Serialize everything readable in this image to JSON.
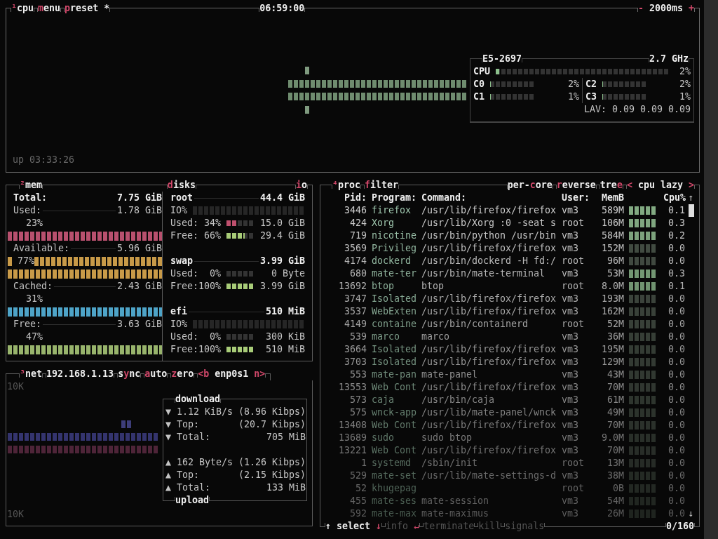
{
  "cpu": {
    "tabs": [
      {
        "parts": [
          {
            "text": "¹",
            "hot": true
          },
          {
            "text": "cpu",
            "hot": false
          }
        ]
      },
      {
        "parts": [
          {
            "text": "m",
            "hot": true
          },
          {
            "text": "enu",
            "hot": false
          }
        ]
      },
      {
        "parts": [
          {
            "text": "p",
            "hot": true
          },
          {
            "text": "reset *",
            "hot": false
          }
        ]
      }
    ],
    "clock": "06:59:00",
    "interval": {
      "parts": [
        {
          "text": "-",
          "hot": true
        },
        {
          "text": " 2000ms ",
          "hot": false
        },
        {
          "text": "+",
          "hot": true
        }
      ]
    },
    "cpu_model": "E5-2697",
    "frequency": "2.7 GHz",
    "total": {
      "label": "CPU",
      "level": 0.02,
      "reading": "2%"
    },
    "cores": [
      {
        "label": "C0",
        "level": 0.02,
        "reading": "2%"
      },
      {
        "label": "C1",
        "level": 0.01,
        "reading": "1%"
      },
      {
        "label": "C2",
        "level": 0.02,
        "reading": "2%"
      },
      {
        "label": "C3",
        "level": 0.01,
        "reading": "1%"
      }
    ],
    "load_average": {
      "label": "LAV:",
      "values": [
        "0.09",
        "0.09",
        "0.09"
      ]
    },
    "uptime": "up 03:33:26"
  },
  "mem": {
    "title": {
      "parts": [
        {
          "text": "²",
          "hot": true
        },
        {
          "text": "mem",
          "hot": false
        }
      ]
    },
    "items": [
      {
        "kind": "total",
        "label": "Total:",
        "value": "7.75 GiB"
      },
      {
        "kind": "stacked",
        "label": "Used:",
        "value": "1.78 GiB",
        "percent": "23%",
        "color": "#b8506e"
      },
      {
        "kind": "inline",
        "label": "Available:",
        "value": "5.96 GiB",
        "percent": "77%",
        "color": "#c89a48"
      },
      {
        "kind": "stacked",
        "label": "Cached:",
        "value": "2.43 GiB",
        "percent": "31%",
        "color": "#4ea4c8"
      },
      {
        "kind": "stacked",
        "label": "Free:",
        "value": "3.63 GiB",
        "percent": "47%",
        "color": "#98b46c"
      }
    ]
  },
  "disks": {
    "title": {
      "parts": [
        {
          "text": "d",
          "hot": true
        },
        {
          "text": "isks",
          "hot": false
        }
      ]
    },
    "io_button": {
      "parts": [
        {
          "text": "i",
          "hot": true
        },
        {
          "text": "o",
          "hot": false
        }
      ]
    },
    "items": [
      {
        "name": "root",
        "size": "44.4 GiB",
        "io_label": "IO%",
        "used": {
          "label": "Used:",
          "percent": "34%",
          "level": 0.34,
          "value": "15.0 GiB"
        },
        "free": {
          "label": "Free:",
          "percent": "66%",
          "level": 0.66,
          "value": "29.4 GiB"
        }
      },
      {
        "name": "swap",
        "size": "3.99 GiB",
        "used": {
          "label": "Used:",
          "percent": "0%",
          "level": 0,
          "value": "0 Byte"
        },
        "free": {
          "label": "Free:",
          "percent": "100%",
          "level": 1,
          "value": "3.99 GiB"
        }
      },
      {
        "name": "efi",
        "size": "510 MiB",
        "io_label": "IO%",
        "used": {
          "label": "Used:",
          "percent": "0%",
          "level": 0,
          "value": "300 KiB"
        },
        "free": {
          "label": "Free:",
          "percent": "100%",
          "level": 1,
          "value": "510 MiB"
        }
      }
    ]
  },
  "net": {
    "tabs": [
      {
        "parts": [
          {
            "text": "³",
            "hot": true
          },
          {
            "text": "net",
            "hot": false
          }
        ]
      },
      {
        "parts": [
          {
            "text": "192.168.1.13",
            "hot": false
          }
        ]
      },
      {
        "parts": [
          {
            "text": "s",
            "hot": false
          },
          {
            "text": "y",
            "hot": true
          },
          {
            "text": "nc",
            "hot": false
          }
        ]
      },
      {
        "parts": [
          {
            "text": "a",
            "hot": true
          },
          {
            "text": "uto",
            "hot": false
          }
        ]
      },
      {
        "parts": [
          {
            "text": "z",
            "hot": true
          },
          {
            "text": "ero",
            "hot": false
          }
        ]
      },
      {
        "parts": [
          {
            "text": "<b",
            "hot": true
          },
          {
            "text": " enp0s1 ",
            "hot": false
          },
          {
            "text": "n>",
            "hot": true
          }
        ]
      }
    ],
    "scale_top": "10K",
    "scale_bottom": "10K",
    "download": {
      "title": "download",
      "rows": [
        {
          "icon": "▼",
          "label": "1.12 KiB/s",
          "value": "(8.96 Kibps)"
        },
        {
          "icon": "▼",
          "label": "Top:",
          "value": "(20.7 Kibps)"
        },
        {
          "icon": "▼",
          "label": "Total:",
          "value": "705 MiB"
        }
      ]
    },
    "upload": {
      "title": "upload",
      "rows": [
        {
          "icon": "▲",
          "label": "162 Byte/s",
          "value": "(1.26 Kibps)"
        },
        {
          "icon": "▲",
          "label": "Top:",
          "value": "(2.15 Kibps)"
        },
        {
          "icon": "▲",
          "label": "Total:",
          "value": "133 MiB"
        }
      ]
    }
  },
  "proc": {
    "tabs_left": [
      {
        "parts": [
          {
            "text": "⁴",
            "hot": true
          },
          {
            "text": "proc",
            "hot": false
          }
        ]
      },
      {
        "parts": [
          {
            "text": "f",
            "hot": true
          },
          {
            "text": "ilter",
            "hot": false
          }
        ]
      }
    ],
    "tabs_right": [
      {
        "parts": [
          {
            "text": "per-",
            "hot": false
          },
          {
            "text": "c",
            "hot": true
          },
          {
            "text": "ore",
            "hot": false
          }
        ]
      },
      {
        "parts": [
          {
            "text": "r",
            "hot": true
          },
          {
            "text": "everse",
            "hot": false
          }
        ]
      },
      {
        "parts": [
          {
            "text": "tre",
            "hot": false
          },
          {
            "text": "e",
            "hot": true
          }
        ]
      },
      {
        "parts": [
          {
            "text": "<",
            "hot": true
          },
          {
            "text": " cpu lazy ",
            "hot": false
          },
          {
            "text": ">",
            "hot": true
          }
        ]
      }
    ],
    "columns": [
      "Pid:",
      "Program:",
      "Command:",
      "User:",
      "MemB",
      "Cpu%"
    ],
    "scroll_up": "↑",
    "scroll_down": "↓",
    "rows": [
      {
        "pid": "3446",
        "program": "firefox",
        "command": "/usr/lib/firefox/firefox",
        "user": "vm3",
        "mem": "589M",
        "cpu": "0.1"
      },
      {
        "pid": "424",
        "program": "Xorg",
        "command": "/usr/lib/Xorg :0 -seat s",
        "user": "root",
        "mem": "106M",
        "cpu": "0.3"
      },
      {
        "pid": "719",
        "program": "nicotine",
        "command": "/usr/bin/python /usr/bin",
        "user": "vm3",
        "mem": "584M",
        "cpu": "0.2"
      },
      {
        "pid": "3569",
        "program": "Privileg",
        "command": "/usr/lib/firefox/firefox",
        "user": "vm3",
        "mem": "152M",
        "cpu": "0.0"
      },
      {
        "pid": "4174",
        "program": "dockerd",
        "command": "/usr/bin/dockerd -H fd:/",
        "user": "root",
        "mem": "96M",
        "cpu": "0.0"
      },
      {
        "pid": "680",
        "program": "mate-ter",
        "command": "/usr/bin/mate-terminal",
        "user": "vm3",
        "mem": "53M",
        "cpu": "0.3"
      },
      {
        "pid": "13692",
        "program": "btop",
        "command": "btop",
        "user": "root",
        "mem": "8.0M",
        "cpu": "0.1"
      },
      {
        "pid": "3747",
        "program": "Isolated",
        "command": "/usr/lib/firefox/firefox",
        "user": "vm3",
        "mem": "193M",
        "cpu": "0.0"
      },
      {
        "pid": "3537",
        "program": "WebExten",
        "command": "/usr/lib/firefox/firefox",
        "user": "vm3",
        "mem": "162M",
        "cpu": "0.0"
      },
      {
        "pid": "4149",
        "program": "containe",
        "command": "/usr/bin/containerd",
        "user": "root",
        "mem": "52M",
        "cpu": "0.0"
      },
      {
        "pid": "539",
        "program": "marco",
        "command": "marco",
        "user": "vm3",
        "mem": "36M",
        "cpu": "0.0"
      },
      {
        "pid": "3664",
        "program": "Isolated",
        "command": "/usr/lib/firefox/firefox",
        "user": "vm3",
        "mem": "195M",
        "cpu": "0.0"
      },
      {
        "pid": "3703",
        "program": "Isolated",
        "command": "/usr/lib/firefox/firefox",
        "user": "vm3",
        "mem": "129M",
        "cpu": "0.0"
      },
      {
        "pid": "553",
        "program": "mate-pan",
        "command": "mate-panel",
        "user": "vm3",
        "mem": "43M",
        "cpu": "0.0"
      },
      {
        "pid": "13553",
        "program": "Web Cont",
        "command": "/usr/lib/firefox/firefox",
        "user": "vm3",
        "mem": "70M",
        "cpu": "0.0"
      },
      {
        "pid": "573",
        "program": "caja",
        "command": "/usr/bin/caja",
        "user": "vm3",
        "mem": "61M",
        "cpu": "0.0"
      },
      {
        "pid": "575",
        "program": "wnck-app",
        "command": "/usr/lib/mate-panel/wnck",
        "user": "vm3",
        "mem": "49M",
        "cpu": "0.0"
      },
      {
        "pid": "13408",
        "program": "Web Cont",
        "command": "/usr/lib/firefox/firefox",
        "user": "vm3",
        "mem": "70M",
        "cpu": "0.0"
      },
      {
        "pid": "13689",
        "program": "sudo",
        "command": "sudo btop",
        "user": "vm3",
        "mem": "9.0M",
        "cpu": "0.0"
      },
      {
        "pid": "13221",
        "program": "Web Cont",
        "command": "/usr/lib/firefox/firefox",
        "user": "vm3",
        "mem": "70M",
        "cpu": "0.0"
      },
      {
        "pid": "1",
        "program": "systemd",
        "command": "/sbin/init",
        "user": "root",
        "mem": "13M",
        "cpu": "0.0"
      },
      {
        "pid": "529",
        "program": "mate-set",
        "command": "/usr/lib/mate-settings-d",
        "user": "vm3",
        "mem": "38M",
        "cpu": "0.0"
      },
      {
        "pid": "52",
        "program": "khugepag",
        "user": "root",
        "mem": "0B",
        "cpu": "0.0"
      },
      {
        "pid": "455",
        "program": "mate-ses",
        "command": "mate-session",
        "user": "vm3",
        "mem": "54M",
        "cpu": "0.0"
      },
      {
        "pid": "592",
        "program": "mate-max",
        "command": "mate-maximus",
        "user": "vm3",
        "mem": "26M",
        "cpu": "0.0"
      }
    ],
    "footer": [
      {
        "parts": [
          {
            "text": "↑",
            "hot": false
          },
          {
            "text": " select ",
            "hot": false
          },
          {
            "text": "↓",
            "hot": true
          }
        ],
        "disabled": false
      },
      {
        "parts": [
          {
            "text": "info",
            "hot": false
          },
          {
            "text": " ↵",
            "hot": true
          }
        ],
        "disabled": true
      },
      {
        "parts": [
          {
            "text": "terminate",
            "hot": false
          }
        ],
        "disabled": true
      },
      {
        "parts": [
          {
            "text": "kill",
            "hot": false
          }
        ],
        "disabled": true
      },
      {
        "parts": [
          {
            "text": "signals",
            "hot": false
          }
        ],
        "disabled": true
      }
    ],
    "count": "0/160"
  }
}
